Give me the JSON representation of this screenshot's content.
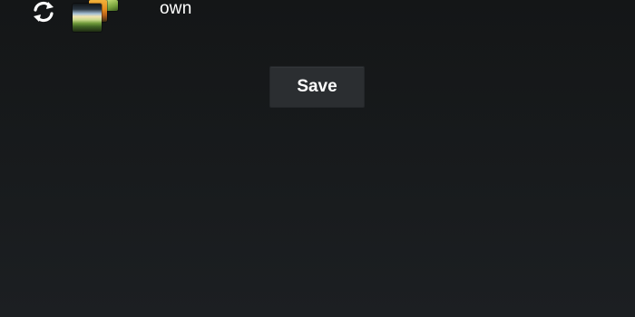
{
  "option_row": {
    "icon": "refresh-icon",
    "thumbnail_icon": "photo-stack-icon",
    "label": "own"
  },
  "actions": {
    "save_label": "Save"
  },
  "colors": {
    "background": "#171a1c",
    "button_background": "#2b2e31",
    "text": "#ffffff"
  }
}
